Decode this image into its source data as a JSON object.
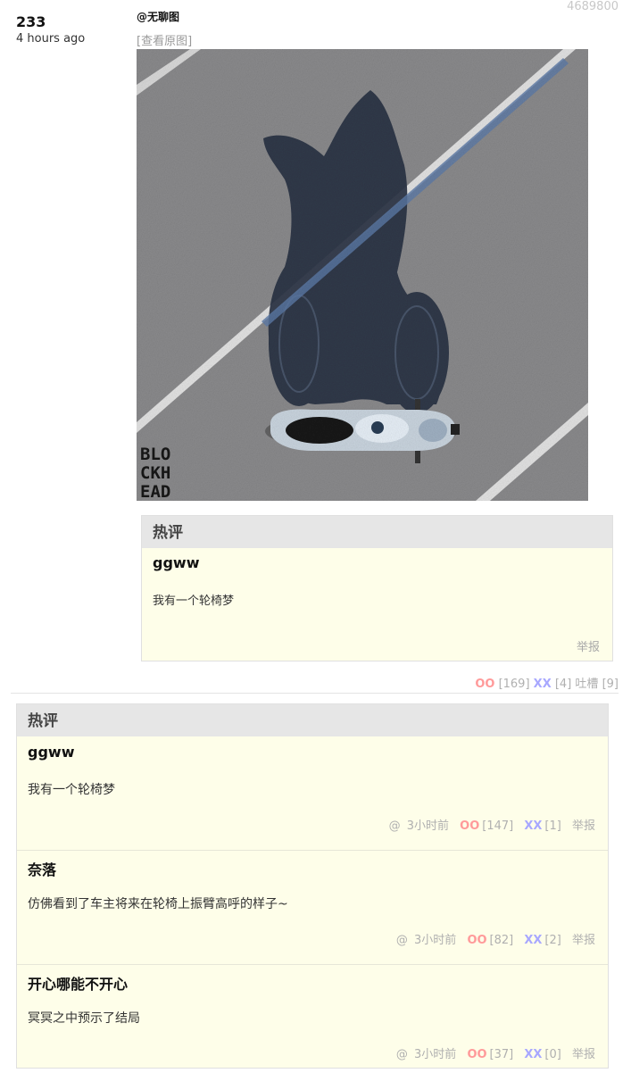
{
  "post": {
    "id": "233",
    "time": "4 hours ago",
    "number": "4689800",
    "author": "@无聊图",
    "view_original": "[查看原图]",
    "image": {
      "icon": "motorcycle-shadow-photo",
      "watermark_lines": [
        "BLO",
        "CKH",
        "EAD"
      ]
    },
    "votes": {
      "oo_label": "OO",
      "oo_count": "[169]",
      "xx_label": "XX",
      "xx_count": "[4]",
      "tucao_label": "吐槽",
      "tucao_count": "[9]"
    }
  },
  "inline_hot": {
    "title": "热评",
    "name": "ggww",
    "text": "我有一个轮椅梦",
    "report": "举报"
  },
  "hot_list": {
    "title": "热评",
    "comments": [
      {
        "name": "ggww",
        "text": "我有一个轮椅梦",
        "at": "@",
        "time": "3小时前",
        "oo_label": "OO",
        "oo_count": "[147]",
        "xx_label": "XX",
        "xx_count": "[1]",
        "report": "举报"
      },
      {
        "name": "奈落",
        "text": "仿佛看到了车主将来在轮椅上振臂高呼的样子~",
        "at": "@",
        "time": "3小时前",
        "oo_label": "OO",
        "oo_count": "[82]",
        "xx_label": "XX",
        "xx_count": "[2]",
        "report": "举报"
      },
      {
        "name": "开心哪能不开心",
        "text": "冥冥之中预示了结局",
        "at": "@",
        "time": "3小时前",
        "oo_label": "OO",
        "oo_count": "[37]",
        "xx_label": "XX",
        "xx_count": "[0]",
        "report": "举报"
      }
    ]
  },
  "colors": {
    "oo": "#ff9a9a",
    "xx": "#a8a8ff",
    "comment_bg": "#fefee9",
    "header_bg": "#e6e6e6"
  }
}
